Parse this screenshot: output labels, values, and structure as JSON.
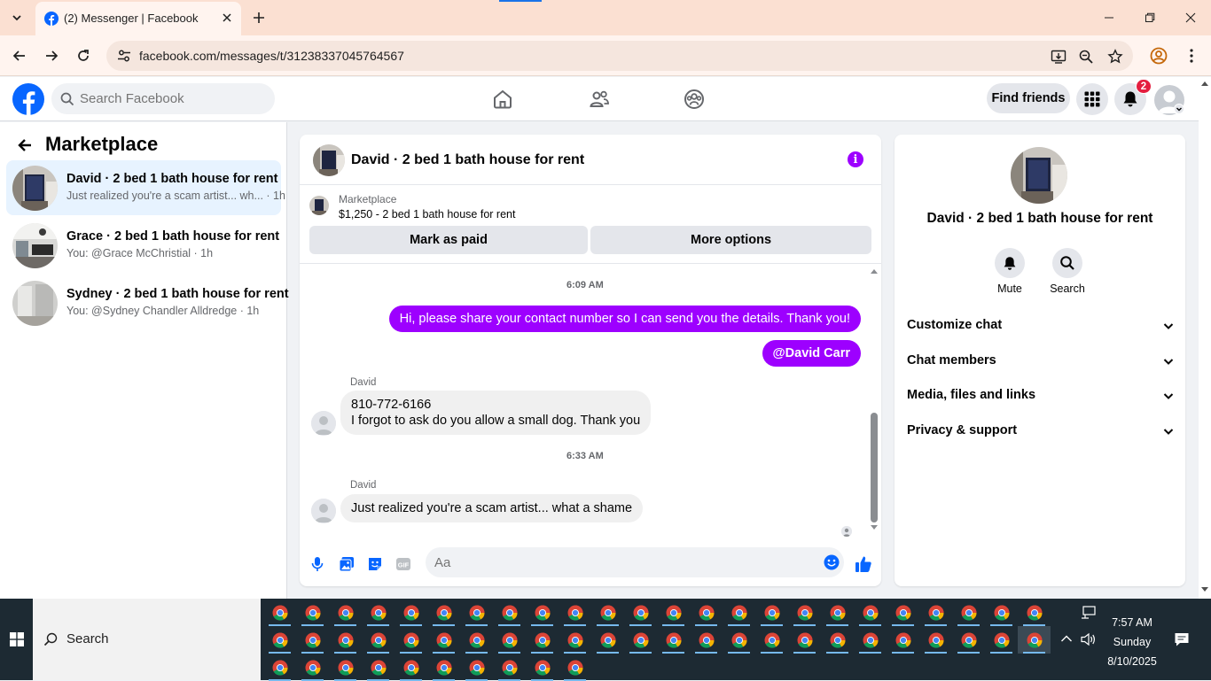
{
  "browser": {
    "tab_title": "(2) Messenger | Facebook",
    "url": "facebook.com/messages/t/31238337045764567"
  },
  "facebook": {
    "search_placeholder": "Search Facebook",
    "find_friends_label": "Find friends",
    "notification_count": "2",
    "brand_color": "#0866ff",
    "chat_accent_color": "#9d00ff"
  },
  "sidebar": {
    "title": "Marketplace",
    "chats": [
      {
        "name": "David · 2 bed 1 bath house for rent",
        "preview": "Just realized you're a scam artist... wh... · 1h",
        "active": true
      },
      {
        "name": "Grace · 2 bed 1 bath house for rent",
        "preview": "You: @Grace McChristial · 1h",
        "active": false
      },
      {
        "name": "Sydney · 2 bed 1 bath house for rent",
        "preview": "You: @Sydney Chandler Alldredge · 1h",
        "active": false
      }
    ]
  },
  "chat": {
    "title": "David · 2 bed 1 bath house for rent",
    "listing_label": "Marketplace",
    "listing_price": "$1,250 - 2 bed 1 bath house for rent",
    "mark_paid_label": "Mark as paid",
    "more_options_label": "More options",
    "messages": {
      "time1": "6:09 AM",
      "out1": "Hi, please share your contact number so I can send you the details. Thank you!",
      "out2": "@David Carr",
      "sender1": "David",
      "in1_line1": "810-772-6166",
      "in1_line2": "I forgot to ask do you allow a small dog. Thank you",
      "time2": "6:33 AM",
      "sender2": "David",
      "in2": "Just realized you're a scam artist... what a shame"
    },
    "input_placeholder": "Aa"
  },
  "info_panel": {
    "name": "David · 2 bed 1 bath house for rent",
    "mute_label": "Mute",
    "search_label": "Search",
    "sections": [
      "Customize chat",
      "Chat members",
      "Media, files and links",
      "Privacy & support"
    ]
  },
  "taskbar": {
    "search_label": "Search",
    "time": "7:57 AM",
    "day": "Sunday",
    "date": "8/10/2025"
  }
}
